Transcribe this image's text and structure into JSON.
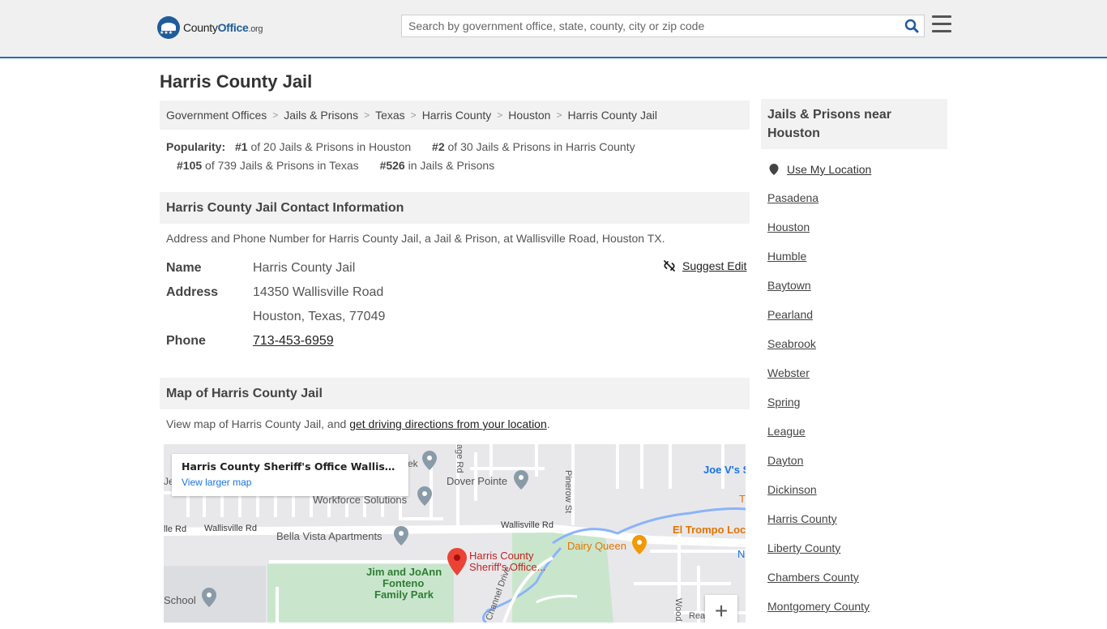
{
  "header": {
    "logo_county": "County",
    "logo_office": "Office",
    "logo_org": ".org",
    "search_placeholder": "Search by government office, state, county, city or zip code"
  },
  "page": {
    "title": "Harris County Jail"
  },
  "breadcrumb": [
    "Government Offices",
    "Jails & Prisons",
    "Texas",
    "Harris County",
    "Houston",
    "Harris County Jail"
  ],
  "popularity": {
    "label": "Popularity:",
    "items": [
      {
        "rank": "#1",
        "text": " of 20 Jails & Prisons in Houston"
      },
      {
        "rank": "#2",
        "text": " of 30 Jails & Prisons in Harris County"
      },
      {
        "rank": "#105",
        "text": " of 739 Jails & Prisons in Texas"
      },
      {
        "rank": "#526",
        "text": " in Jails & Prisons"
      }
    ]
  },
  "contact": {
    "heading": "Harris County Jail Contact Information",
    "description": "Address and Phone Number for Harris County Jail, a Jail & Prison, at Wallisville Road, Houston TX.",
    "suggest_edit": "Suggest Edit",
    "name_label": "Name",
    "name_value": "Harris County Jail",
    "address_label": "Address",
    "address_line1": "14350 Wallisville Road",
    "address_line2": "Houston, Texas, 77049",
    "phone_label": "Phone",
    "phone_value": "713-453-6959"
  },
  "map_section": {
    "heading": "Map of Harris County Jail",
    "desc_prefix": "View map of Harris County Jail, and ",
    "desc_link": "get driving directions from your location",
    "desc_suffix": ".",
    "card_title": "Harris County Sheriff's Office Wallisv...",
    "card_link": "View larger map",
    "zoom_in": "+",
    "labels": {
      "road1": "Wallisville Rd",
      "road2": "Wallisville Rd",
      "road3": "lle Rd",
      "pinerow": "Pinerow St",
      "age_rd": "age Rd",
      "channel": "Channel Drive",
      "woods": "Wood",
      "rea": "Rea",
      "dover": "Dover Pointe",
      "workforce": "Workforce Solutions",
      "bella": "Bella Vista Apartments",
      "park1": "Jim and JoAnn",
      "park2": "Fonteno",
      "park3": "Family Park",
      "school": "School",
      "dairy": "Dairy Queen",
      "trompo": "El Trompo Loc",
      "joes": "Joe V's S",
      "pin1": "Harris County",
      "pin2": "Sheriff's Office...",
      "ek": "ek",
      "je": "Je",
      "n": "N",
      "t": "T"
    }
  },
  "sidebar": {
    "heading": "Jails & Prisons near Houston",
    "use_location": "Use My Location",
    "links": [
      "Pasadena",
      "Houston",
      "Humble",
      "Baytown",
      "Pearland",
      "Seabrook",
      "Webster",
      "Spring",
      "League",
      "Dayton",
      "Dickinson",
      "Harris County",
      "Liberty County",
      "Chambers County",
      "Montgomery County"
    ]
  },
  "colors": {
    "brand_blue": "#1f5d99",
    "map_pin": "#ea4335",
    "park_green": "#c8e6c9",
    "poi_gray": "#8a9ba8",
    "food_orange": "#f29900"
  }
}
